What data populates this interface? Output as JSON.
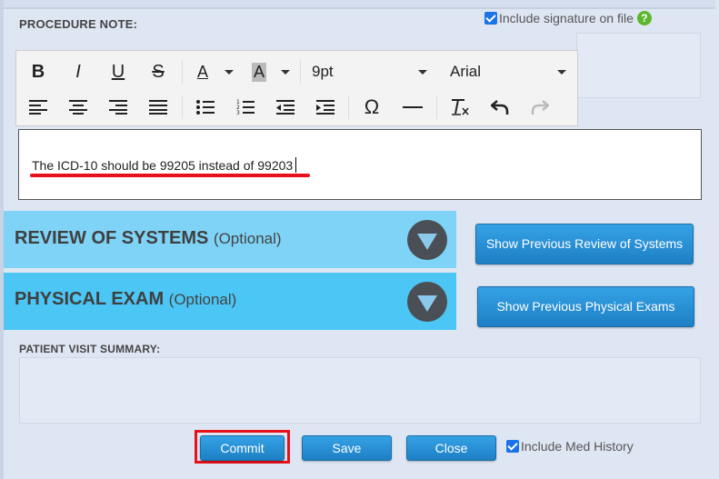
{
  "procedure_note": {
    "label": "PROCEDURE NOTE:",
    "include_signature_label": "Include signature on file",
    "help_glyph": "?",
    "editor_text": "The ICD-10 should be 99205 instead of 99203"
  },
  "toolbar": {
    "font_size": "9pt",
    "font_family": "Arial",
    "bold_glyph": "B",
    "italic_glyph": "I",
    "underline_glyph": "U",
    "strike_glyph": "S",
    "text_color_glyph": "A",
    "bg_color_glyph": "A",
    "omega_glyph": "Ω"
  },
  "sections": {
    "review_of_systems": {
      "title": "REVIEW OF SYSTEMS",
      "optional": "(Optional)",
      "button": "Show Previous Review of Systems"
    },
    "physical_exam": {
      "title": "PHYSICAL EXAM",
      "optional": "(Optional)",
      "button": "Show Previous Physical Exams"
    }
  },
  "patient_visit_summary": {
    "label": "PATIENT VISIT SUMMARY:"
  },
  "actions": {
    "commit": "Commit",
    "save": "Save",
    "close": "Close",
    "include_med_history": "Include Med History"
  },
  "colors": {
    "highlight_red": "#e8111a",
    "ros_bg": "#7fd3f6",
    "pe_bg": "#4cc6f4",
    "button_blue": "#1e7fc4"
  }
}
